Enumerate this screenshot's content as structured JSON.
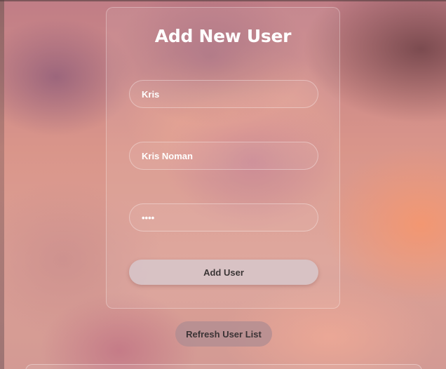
{
  "form": {
    "title": "Add New User",
    "username_value": "Kris",
    "fullname_value": "Kris Noman",
    "password_value": "kris",
    "submit_label": "Add User"
  },
  "actions": {
    "refresh_label": "Refresh User List"
  }
}
